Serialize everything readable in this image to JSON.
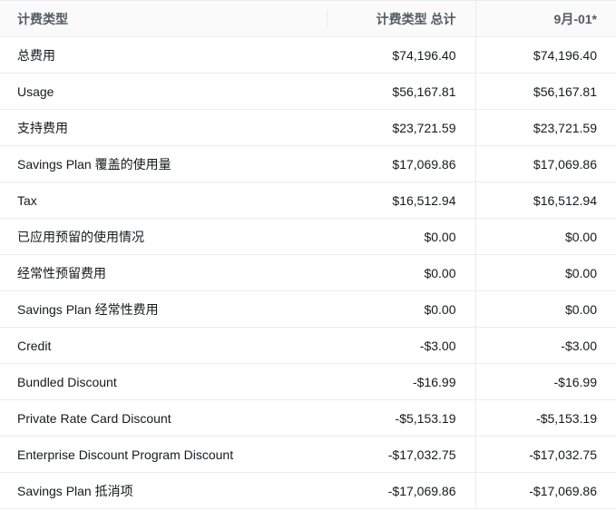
{
  "table": {
    "headers": [
      "计费类型",
      "计费类型 总计",
      "9月-01*"
    ],
    "rows": [
      {
        "label": "总费用",
        "total": "$74,196.40",
        "day": "$74,196.40"
      },
      {
        "label": "Usage",
        "total": "$56,167.81",
        "day": "$56,167.81"
      },
      {
        "label": "支持费用",
        "total": "$23,721.59",
        "day": "$23,721.59"
      },
      {
        "label": "Savings Plan 覆盖的使用量",
        "total": "$17,069.86",
        "day": "$17,069.86"
      },
      {
        "label": "Tax",
        "total": "$16,512.94",
        "day": "$16,512.94"
      },
      {
        "label": "已应用预留的使用情况",
        "total": "$0.00",
        "day": "$0.00"
      },
      {
        "label": "经常性预留费用",
        "total": "$0.00",
        "day": "$0.00"
      },
      {
        "label": "Savings Plan 经常性费用",
        "total": "$0.00",
        "day": "$0.00"
      },
      {
        "label": "Credit",
        "total": "-$3.00",
        "day": "-$3.00"
      },
      {
        "label": "Bundled Discount",
        "total": "-$16.99",
        "day": "-$16.99"
      },
      {
        "label": "Private Rate Card Discount",
        "total": "-$5,153.19",
        "day": "-$5,153.19"
      },
      {
        "label": "Enterprise Discount Program Discount",
        "total": "-$17,032.75",
        "day": "-$17,032.75"
      },
      {
        "label": "Savings Plan 抵消项",
        "total": "-$17,069.86",
        "day": "-$17,069.86"
      }
    ]
  }
}
